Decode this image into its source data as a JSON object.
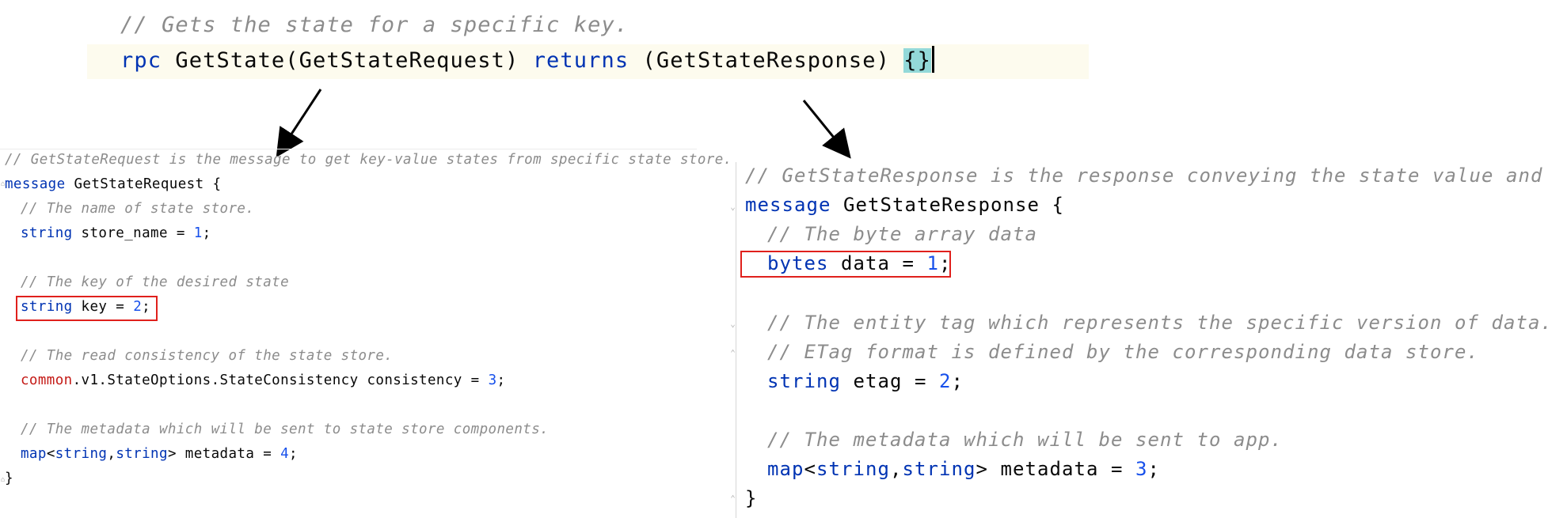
{
  "top": {
    "comment": "// Gets the state for a specific key.",
    "rpc_kw": "rpc",
    "method": " GetState(GetStateRequest) ",
    "returns_kw": "returns",
    "response": " (GetStateResponse) ",
    "braces": "{}"
  },
  "left": {
    "l1": "// GetStateRequest is the message to get key-value states from specific state store.",
    "l2_kw": "message",
    "l2_rest": " GetStateRequest {",
    "l3": "// The name of state store.",
    "l4_type": "string",
    "l4_rest": " store_name = ",
    "l4_num": "1",
    "l4_end": ";",
    "l5": "// The key of the desired state",
    "l6_type": "string",
    "l6_rest": " key = ",
    "l6_num": "2",
    "l6_end": ";",
    "l7": "// The read consistency of the state store.",
    "l8_ns": "common",
    "l8_rest": ".v1.StateOptions.StateConsistency consistency = ",
    "l8_num": "3",
    "l8_end": ";",
    "l9": "// The metadata which will be sent to state store components.",
    "l10_map": "map",
    "l10_lt": "<",
    "l10_t1": "string",
    "l10_comma": ",",
    "l10_t2": "string",
    "l10_rest": "> metadata = ",
    "l10_num": "4",
    "l10_end": ";",
    "l11": "}"
  },
  "right": {
    "r1": "// GetStateResponse is the response conveying the state value and etag.",
    "r2_kw": "message",
    "r2_rest": " GetStateResponse {",
    "r3": "// The byte array data",
    "r4_type": "bytes",
    "r4_rest": " data = ",
    "r4_num": "1",
    "r4_end": ";",
    "r5": "// The entity tag which represents the specific version of data.",
    "r6": "// ETag format is defined by the corresponding data store.",
    "r7_type": "string",
    "r7_rest": " etag = ",
    "r7_num": "2",
    "r7_end": ";",
    "r8": "// The metadata which will be sent to app.",
    "r9_map": "map",
    "r9_lt": "<",
    "r9_t1": "string",
    "r9_comma": ",",
    "r9_t2": "string",
    "r9_rest": "> metadata = ",
    "r9_num": "3",
    "r9_end": ";",
    "r10": "}"
  }
}
